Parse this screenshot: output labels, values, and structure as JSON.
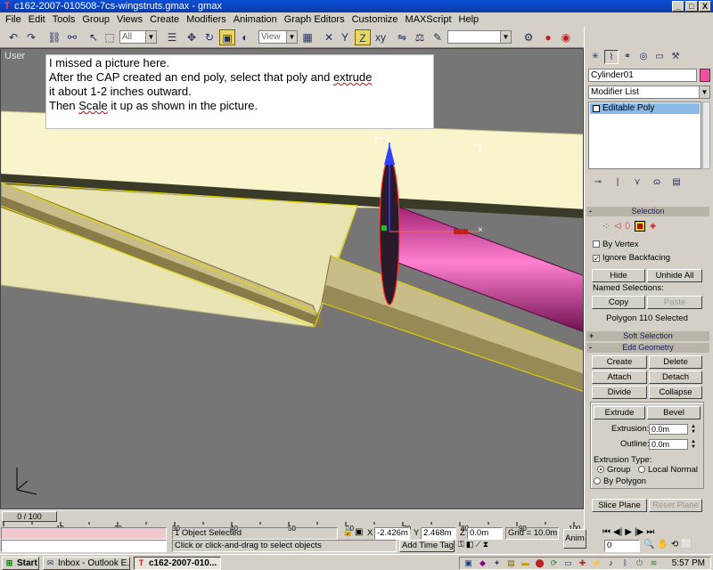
{
  "window": {
    "title": "c162-2007-010508-7cs-wingstruts.gmax - gmax",
    "minimize": "_",
    "maximize": "□",
    "close": "X"
  },
  "menu": [
    "File",
    "Edit",
    "Tools",
    "Group",
    "Views",
    "Create",
    "Modifiers",
    "Animation",
    "Graph Editors",
    "Customize",
    "MAXScript",
    "Help"
  ],
  "toolbar": {
    "selection_filter": "All",
    "ref_coord": "View",
    "named_sel": ""
  },
  "viewport": {
    "label": "User",
    "gizmo_axis": "Z",
    "note_lines": [
      "I missed a picture here.",
      "After the CAP created an end poly, select that poly and ",
      "extrude",
      "it about 1-2 inches outward.",
      "Then ",
      "Scale",
      " it up as shown in the picture."
    ]
  },
  "command_panel": {
    "object_name": "Cylinder01",
    "object_color": "#f050a0",
    "modifier_list": "Modifier List",
    "stack_item": "Editable Poly",
    "selection": {
      "header": "Selection",
      "by_vertex": "By Vertex",
      "ignore_backfacing": "Ignore Backfacing",
      "hide": "Hide",
      "unhide_all": "Unhide All",
      "named_selections": "Named Selections:",
      "copy": "Copy",
      "paste": "Paste",
      "status": "Polygon 110 Selected"
    },
    "soft_selection": "Soft Selection",
    "edit_geometry": {
      "header": "Edit Geometry",
      "create": "Create",
      "delete": "Delete",
      "attach": "Attach",
      "detach": "Detach",
      "divide": "Divide",
      "collapse": "Collapse",
      "extrude": "Extrude",
      "bevel": "Bevel",
      "extrusion_label": "Extrusion:",
      "extrusion_value": "0.0m",
      "outline_label": "Outline:",
      "outline_value": "0.0m",
      "extrusion_type": "Extrusion Type:",
      "group": "Group",
      "local_normal": "Local Normal",
      "by_polygon": "By Polygon",
      "slice_plane": "Slice Plane",
      "reset_plane": "Reset Plane"
    }
  },
  "timeline": {
    "frame": "0 / 100",
    "ticks": [
      "10",
      "20",
      "30",
      "40",
      "50",
      "60",
      "70",
      "80",
      "90",
      "100"
    ]
  },
  "status": {
    "selected": "1 Object Selected",
    "prompt": "Click or click-and-drag to select objects",
    "x_label": "X",
    "x_value": "-2.426m",
    "y_label": "Y",
    "y_value": "2.468m",
    "z_label": "Z",
    "z_value": "0.0m",
    "grid": "Grid = 10.0m",
    "add_time_tag": "Add Time Tag",
    "anim": "Anim",
    "frame_field": "0"
  },
  "taskbar": {
    "start": "Start",
    "tasks": [
      "Inbox - Outlook E...",
      "c162-2007-010..."
    ],
    "clock": "5:57 PM"
  }
}
